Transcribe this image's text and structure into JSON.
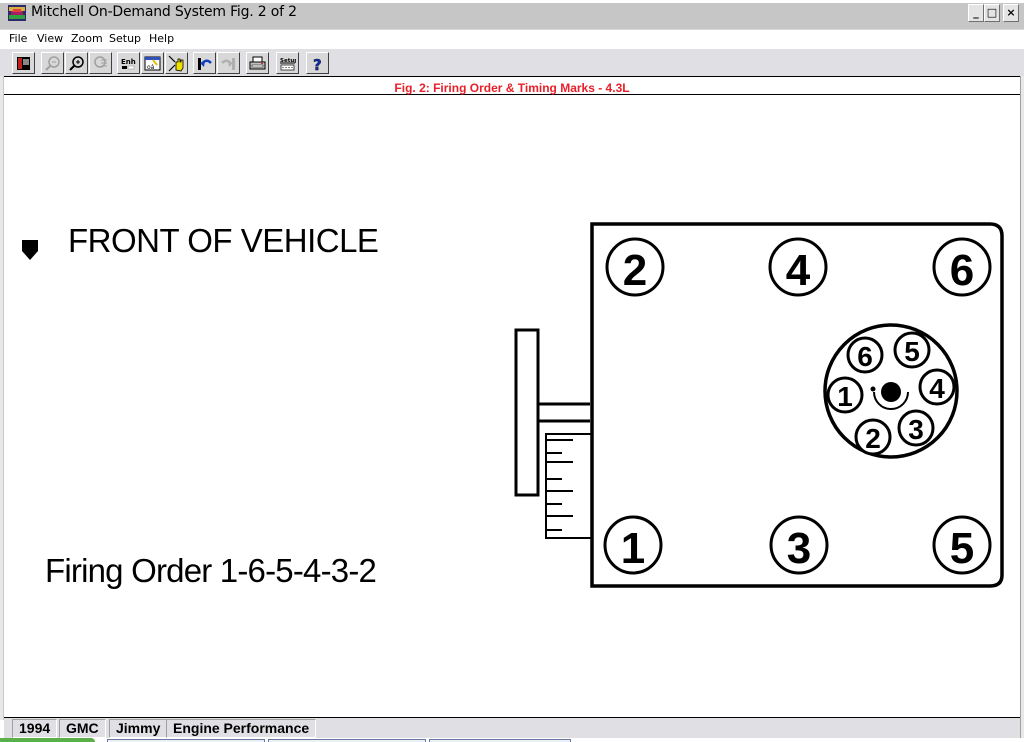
{
  "window": {
    "title": "Mitchell On-Demand System Fig. 2 of 2",
    "controls": {
      "minimize": "_",
      "maximize": "□",
      "close": "×"
    }
  },
  "menu": [
    "File",
    "View",
    "Zoom",
    "Setup",
    "Help"
  ],
  "toolbar": {
    "buttons": [
      {
        "name": "contents-icon",
        "enabled": true
      },
      {
        "name": "zoom-out-icon",
        "enabled": false
      },
      {
        "name": "zoom-in-icon",
        "enabled": true
      },
      {
        "name": "zoom-fit-icon",
        "enabled": false
      },
      {
        "name": "enhance-icon",
        "label": "Enh",
        "enabled": true
      },
      {
        "name": "view-figure-icon",
        "enabled": true
      },
      {
        "name": "pan-hand-icon",
        "enabled": true
      },
      {
        "name": "back-icon",
        "enabled": true
      },
      {
        "name": "forward-icon",
        "enabled": false
      },
      {
        "name": "print-icon",
        "enabled": true
      },
      {
        "name": "setup-icon",
        "label": "Setup",
        "enabled": true
      },
      {
        "name": "help-icon",
        "label": "?",
        "enabled": true
      }
    ]
  },
  "figure": {
    "caption": "Fig. 2:  Firing Order & Timing Marks - 4.3L",
    "front_label": "FRONT OF VEHICLE",
    "firing_order_label": "Firing Order 1-6-5-4-3-2",
    "cylinders_top": [
      "2",
      "4",
      "6"
    ],
    "cylinders_bottom": [
      "1",
      "3",
      "5"
    ],
    "distributor_terminals": [
      "6",
      "5",
      "1",
      "4",
      "2",
      "3"
    ]
  },
  "status": {
    "year": "1994",
    "make": "GMC",
    "model": "Jimmy",
    "section": "Engine Performance"
  }
}
